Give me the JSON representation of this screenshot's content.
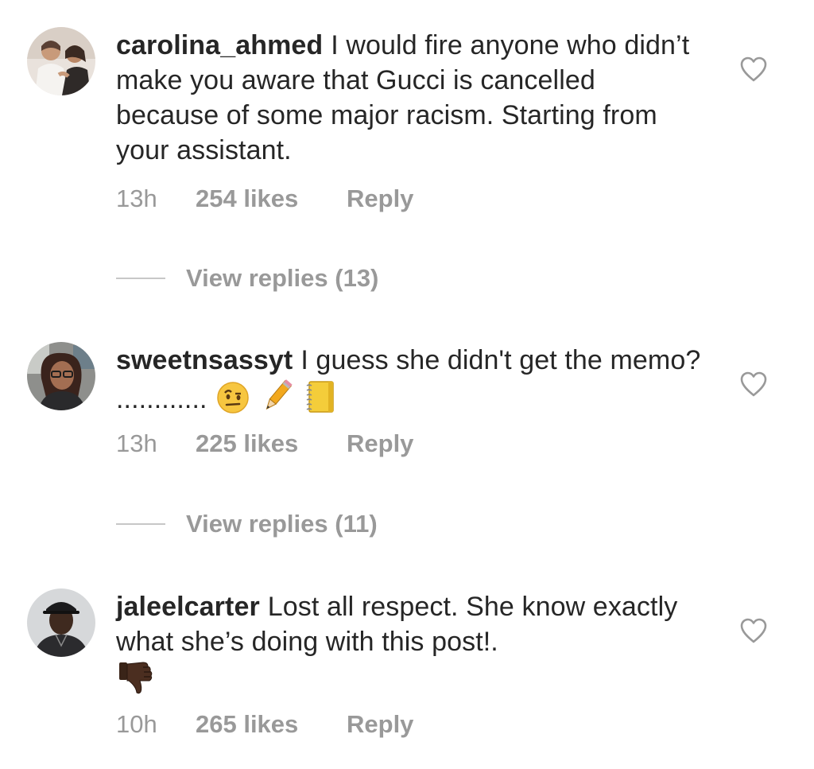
{
  "comments": [
    {
      "username": "carolina_ahmed",
      "text": "I would fire anyone who didn’t make you aware that Gucci is cancelled because of some major racism. Starting from your assistant.",
      "time": "13h",
      "likes": "254 likes",
      "reply_label": "Reply",
      "view_replies": "View replies (13)",
      "avatar_icon": "photo-avatar-mother-child"
    },
    {
      "username": "sweetnsassyt",
      "text": "I guess she didn't get the memo? ............",
      "emojis": [
        "raised-eyebrow-face-emoji",
        "pencil-emoji",
        "notebook-emoji"
      ],
      "time": "13h",
      "likes": "225 likes",
      "reply_label": "Reply",
      "view_replies": "View replies (11)",
      "avatar_icon": "photo-avatar-woman-glasses"
    },
    {
      "username": "jaleelcarter",
      "text": "Lost all respect. She know exactly what she’s doing with this post!.",
      "emojis": [
        "thumbs-down-emoji"
      ],
      "time": "10h",
      "likes": "265 likes",
      "reply_label": "Reply",
      "avatar_icon": "photo-avatar-man-cap"
    }
  ],
  "colors": {
    "text": "#262626",
    "meta": "#999999",
    "heart_stroke": "#999999",
    "divider": "#c7c7c7"
  }
}
